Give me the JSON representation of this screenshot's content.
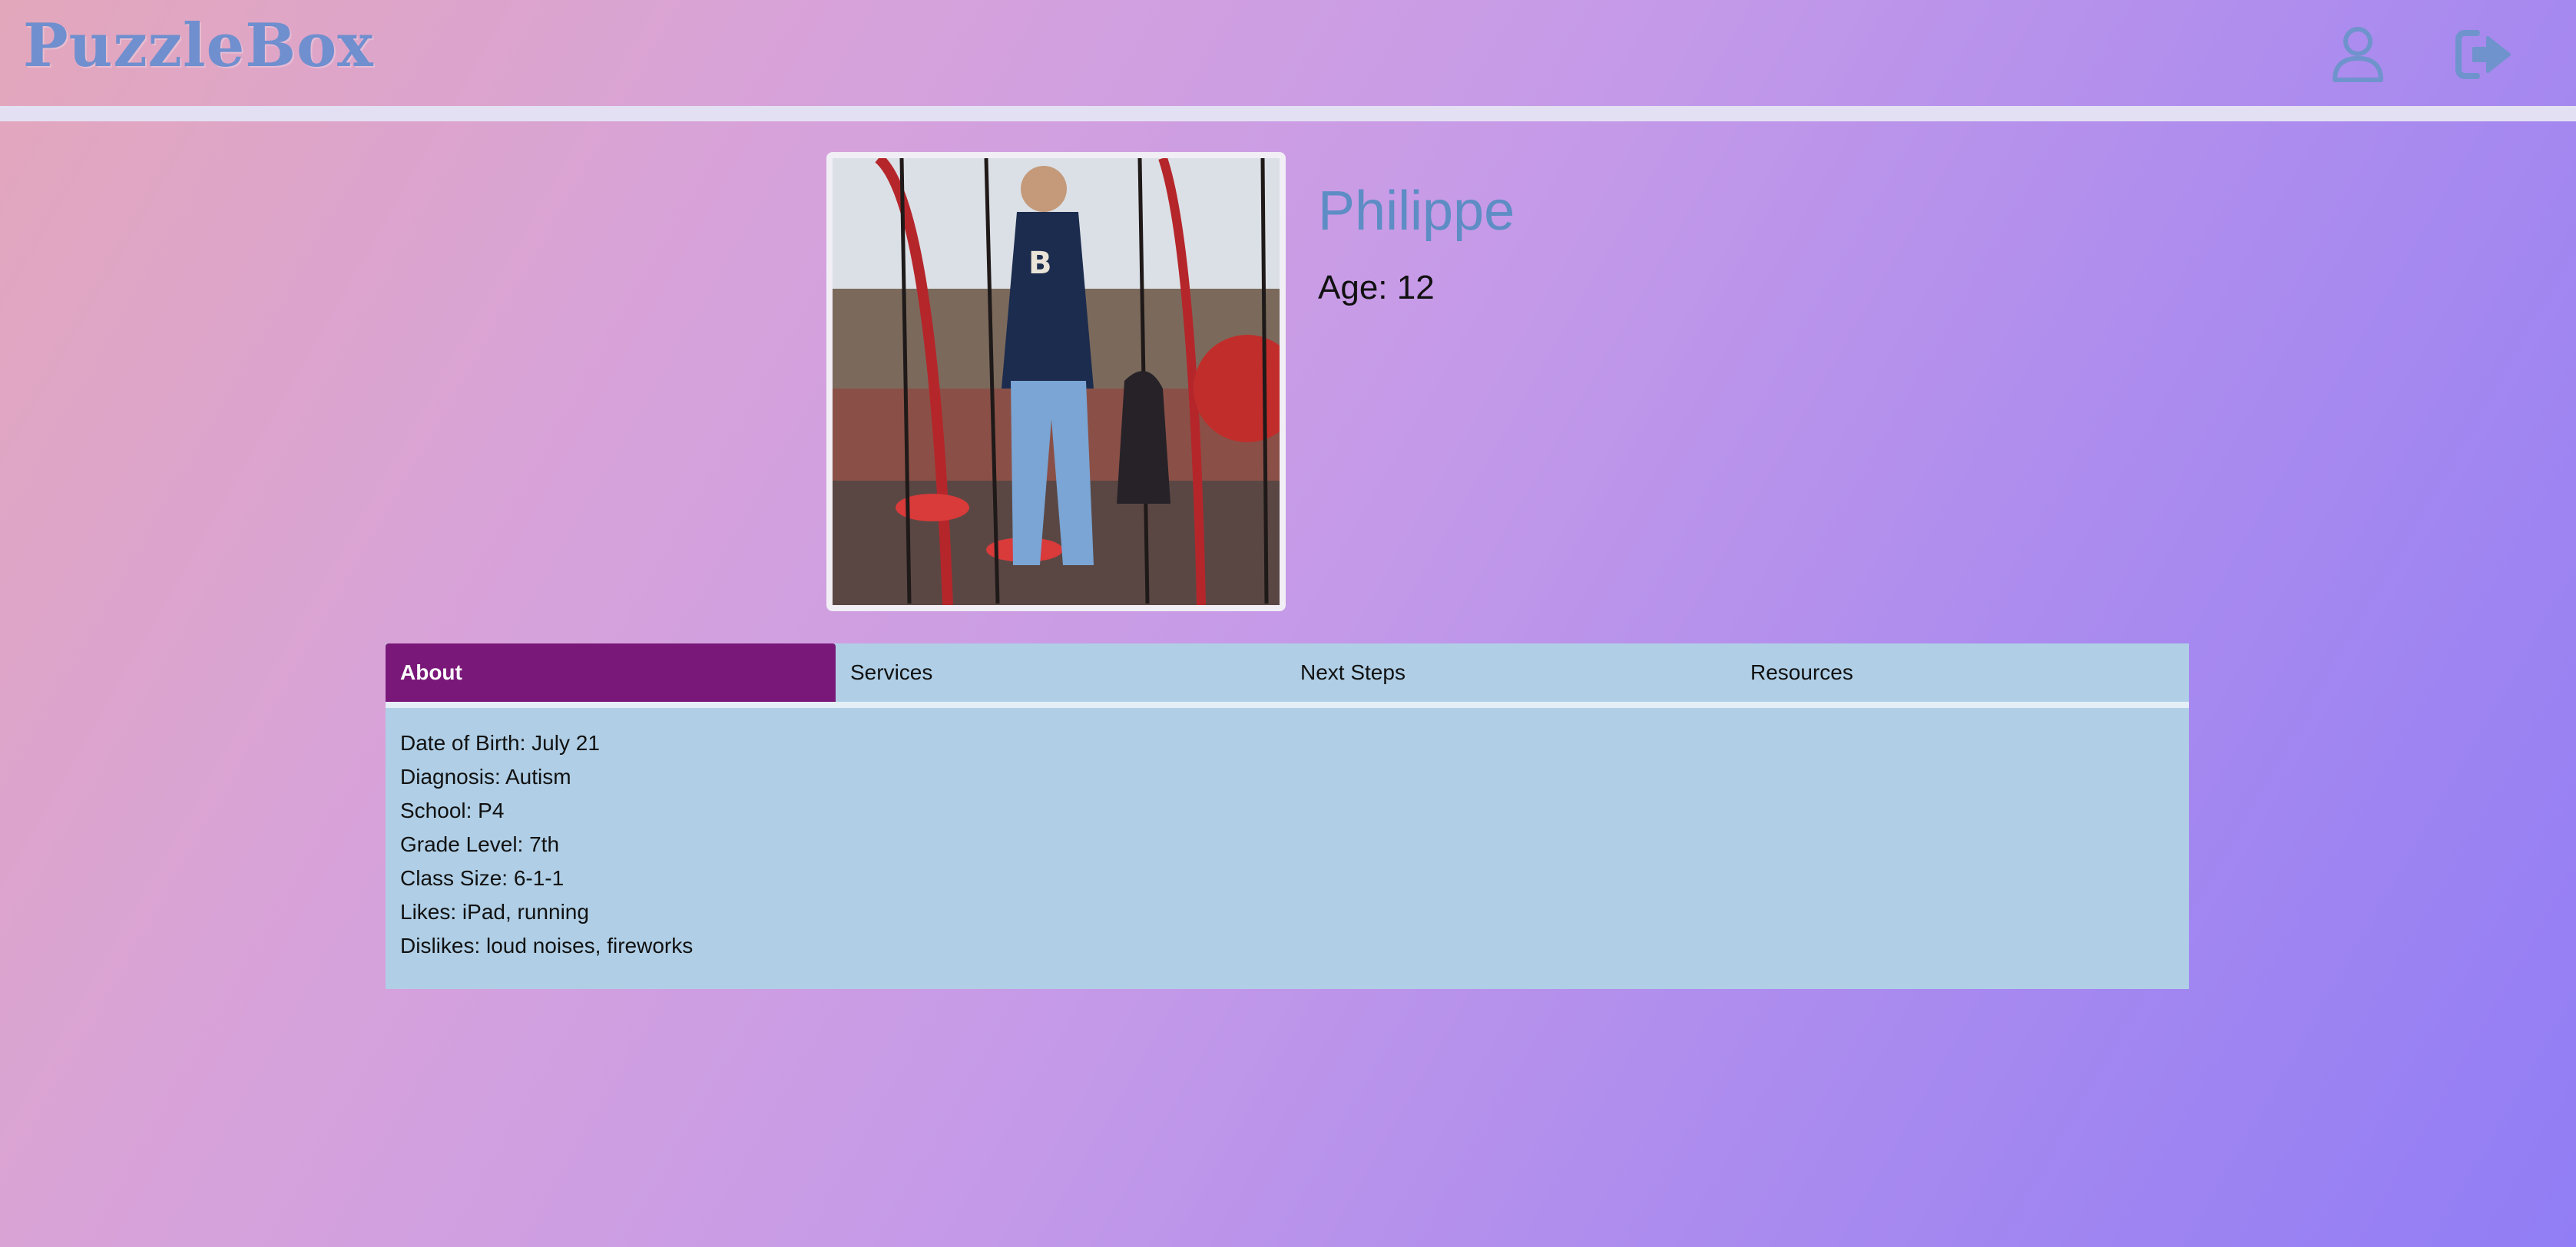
{
  "app": {
    "title": "PuzzleBox"
  },
  "header": {
    "user_icon": "user-icon",
    "logout_icon": "logout-icon"
  },
  "profile": {
    "name": "Philippe",
    "age": "Age: 12",
    "photo_alt": "photo of child on playground climbing structure"
  },
  "tabs": [
    {
      "label": "About",
      "active": true
    },
    {
      "label": "Services",
      "active": false
    },
    {
      "label": "Next Steps",
      "active": false
    },
    {
      "label": "Resources",
      "active": false
    }
  ],
  "about": {
    "items": [
      "Date of Birth: July 21",
      "Diagnosis: Autism",
      "School: P4",
      "Grade Level: 7th",
      "Class Size: 6-1-1",
      "Likes: iPad, running",
      "Dislikes: loud noises, fireworks"
    ]
  },
  "colors": {
    "brand": "#6f8fcf",
    "active_tab": "#7a1879",
    "panel": "#b0cfe6",
    "name": "#5d8dc4"
  }
}
